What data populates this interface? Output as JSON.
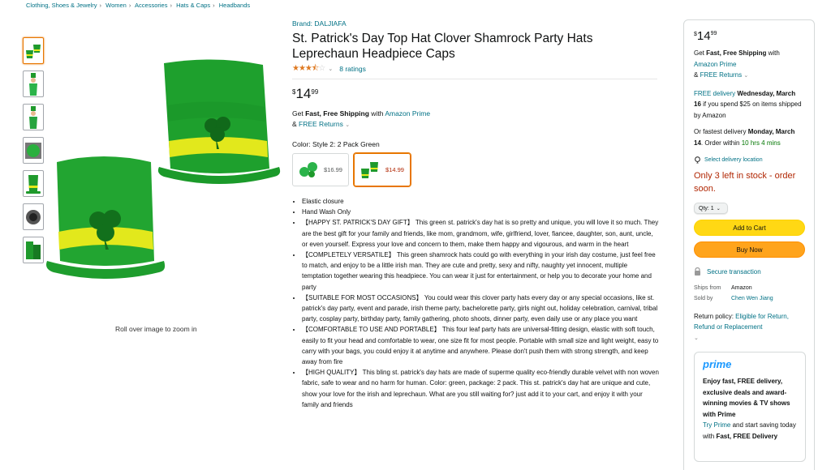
{
  "breadcrumb": [
    "Clothing, Shoes & Jewelry",
    "Women",
    "Accessories",
    "Hats & Caps",
    "Headbands"
  ],
  "breadcrumb_sep": "›",
  "product": {
    "brand": "Brand: DALJIAFA",
    "title": "St. Patrick's Day Top Hat Clover Shamrock Party Hats Leprechaun Headpiece Caps",
    "rating": 3.5,
    "ratings_text": "8 ratings",
    "price_symbol": "$",
    "price_whole": "14",
    "price_fraction": "99",
    "shipping_prefix": "Get ",
    "shipping_bold": "Fast, Free Shipping",
    "shipping_with": " with ",
    "shipping_prime": "Amazon Prime",
    "returns_prefix": "& ",
    "returns_link": "FREE Returns",
    "color_label": "Color: ",
    "color_value": "Style 2: 2 Pack Green",
    "zoom_hint": "Roll over image to zoom in"
  },
  "swatches": [
    {
      "price": "$16.99",
      "selected": false
    },
    {
      "price": "$14.99",
      "selected": true
    }
  ],
  "bullets": [
    "Elastic closure",
    "Hand Wash Only",
    "【HAPPY ST. PATRICK'S DAY GIFT】 This green st. patrick's day hat is so pretty and unique, you will love it so much. They are the best gift for your family and friends, like mom, grandmom, wife, girlfriend, lover, fiancee, daughter, son, aunt, uncle, or even yourself. Express your love and concern to them, make them happy and vigourous, and warm in the heart",
    "【COMPLETELY VERSATILE】 This green shamrock hats could go with everything in your irish day costume, just feel free to match, and enjoy to be a little irish man. They are cute and pretty, sexy and nifty, naughty yet innocent, multiple temptation together wearing this headpiece. You can wear it just for entertainment, or help you to decorate your home and party",
    "【SUITABLE FOR MOST OCCASIONS】 You could wear this clover party hats every day or any special occasions, like st. patrick's day party, event and parade, irish theme party, bachelorette party, girls night out, holiday celebration, carnival, tribal party, cosplay party, birthday party, family gathering, photo shoots, dinner party, even daily use or any place you want",
    "【COMFORTABLE TO USE AND PORTABLE】 This four leaf party hats are universal-fitting design, elastic with soft touch, easily to fit your head and comfortable to wear, one size fit for most people. Portable with small size and light weight, easy to carry with your bags, you could enjoy it at anytime and anywhere. Please don't push them with strong strength, and keep away from fire",
    "【HIGH QUALITY】 This bling st. patrick's day hats are made of superme quality eco-friendly durable velvet with non woven fabric, safe to wear and no harm for human. Color: green, package: 2 pack. This st. patrick's day hat are unique and cute, show your love for the irish and leprechaun. What are you still waiting for? just add it to your cart, and enjoy it with your family and friends"
  ],
  "buybox": {
    "price_symbol": "$",
    "price_whole": "14",
    "price_fraction": "99",
    "ship_prefix": "Get ",
    "ship_bold": "Fast, Free Shipping",
    "ship_with": " with",
    "ship_prime": "Amazon Prime",
    "returns_prefix": "& ",
    "returns_link": "FREE Returns",
    "delivery_link": "FREE delivery",
    "delivery_date": "Wednesday, March 16",
    "delivery_cond": " if you spend $25 on items shipped by Amazon",
    "fastest_prefix": "Or fastest delivery ",
    "fastest_date": "Monday, March 14",
    "fastest_mid": ". Order within ",
    "fastest_time": "10 hrs 4 mins",
    "location_link": "Select delivery location",
    "stock": "Only 3 left in stock - order soon.",
    "qty": "Qty: 1",
    "add_to_cart": "Add to Cart",
    "buy_now": "Buy Now",
    "secure": "Secure transaction",
    "ships_from_label": "Ships from",
    "ships_from": "Amazon",
    "sold_by_label": "Sold by",
    "sold_by": "Chen Wen Jiang",
    "return_label": "Return policy: ",
    "return_link": "Eligible for Return, Refund or Replacement",
    "prime_logo": "prime",
    "prime_bold": "Enjoy fast, FREE delivery, exclusive deals and award-winning movies & TV shows with Prime",
    "prime_try": "Try Prime",
    "prime_rest": " and start saving today with ",
    "prime_bold2": "Fast, FREE Delivery"
  },
  "colors": {
    "link": "#007185",
    "stock": "#b12704",
    "cart_button": "#ffd814",
    "buy_button": "#ffa41c",
    "hat_green": "#1f9a2c",
    "band_yellow": "#e4e81a",
    "star": "#de7921"
  }
}
